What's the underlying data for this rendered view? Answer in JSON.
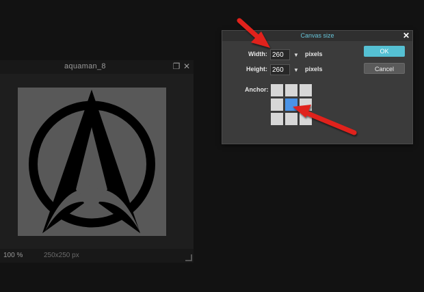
{
  "document": {
    "title": "aquaman_8",
    "restore_icon": "❐",
    "close_icon": "✕",
    "zoom": "100",
    "zoom_unit": "%",
    "image_size": "250x250 px",
    "canvas_color": "#585858"
  },
  "dialog": {
    "title": "Canvas size",
    "close_icon": "✕",
    "width_label": "Width:",
    "width_value": "260",
    "height_label": "Height:",
    "height_value": "260",
    "unit": "pixels",
    "dropdown_icon": "▼",
    "anchor_label": "Anchor:",
    "ok_label": "OK",
    "cancel_label": "Cancel",
    "selected_anchor": "center"
  },
  "colors": {
    "accent": "#55c0d3",
    "title_text": "#66c3d7",
    "anchor_selected": "#4a93e6",
    "annotation_arrow": "#e0211b"
  }
}
